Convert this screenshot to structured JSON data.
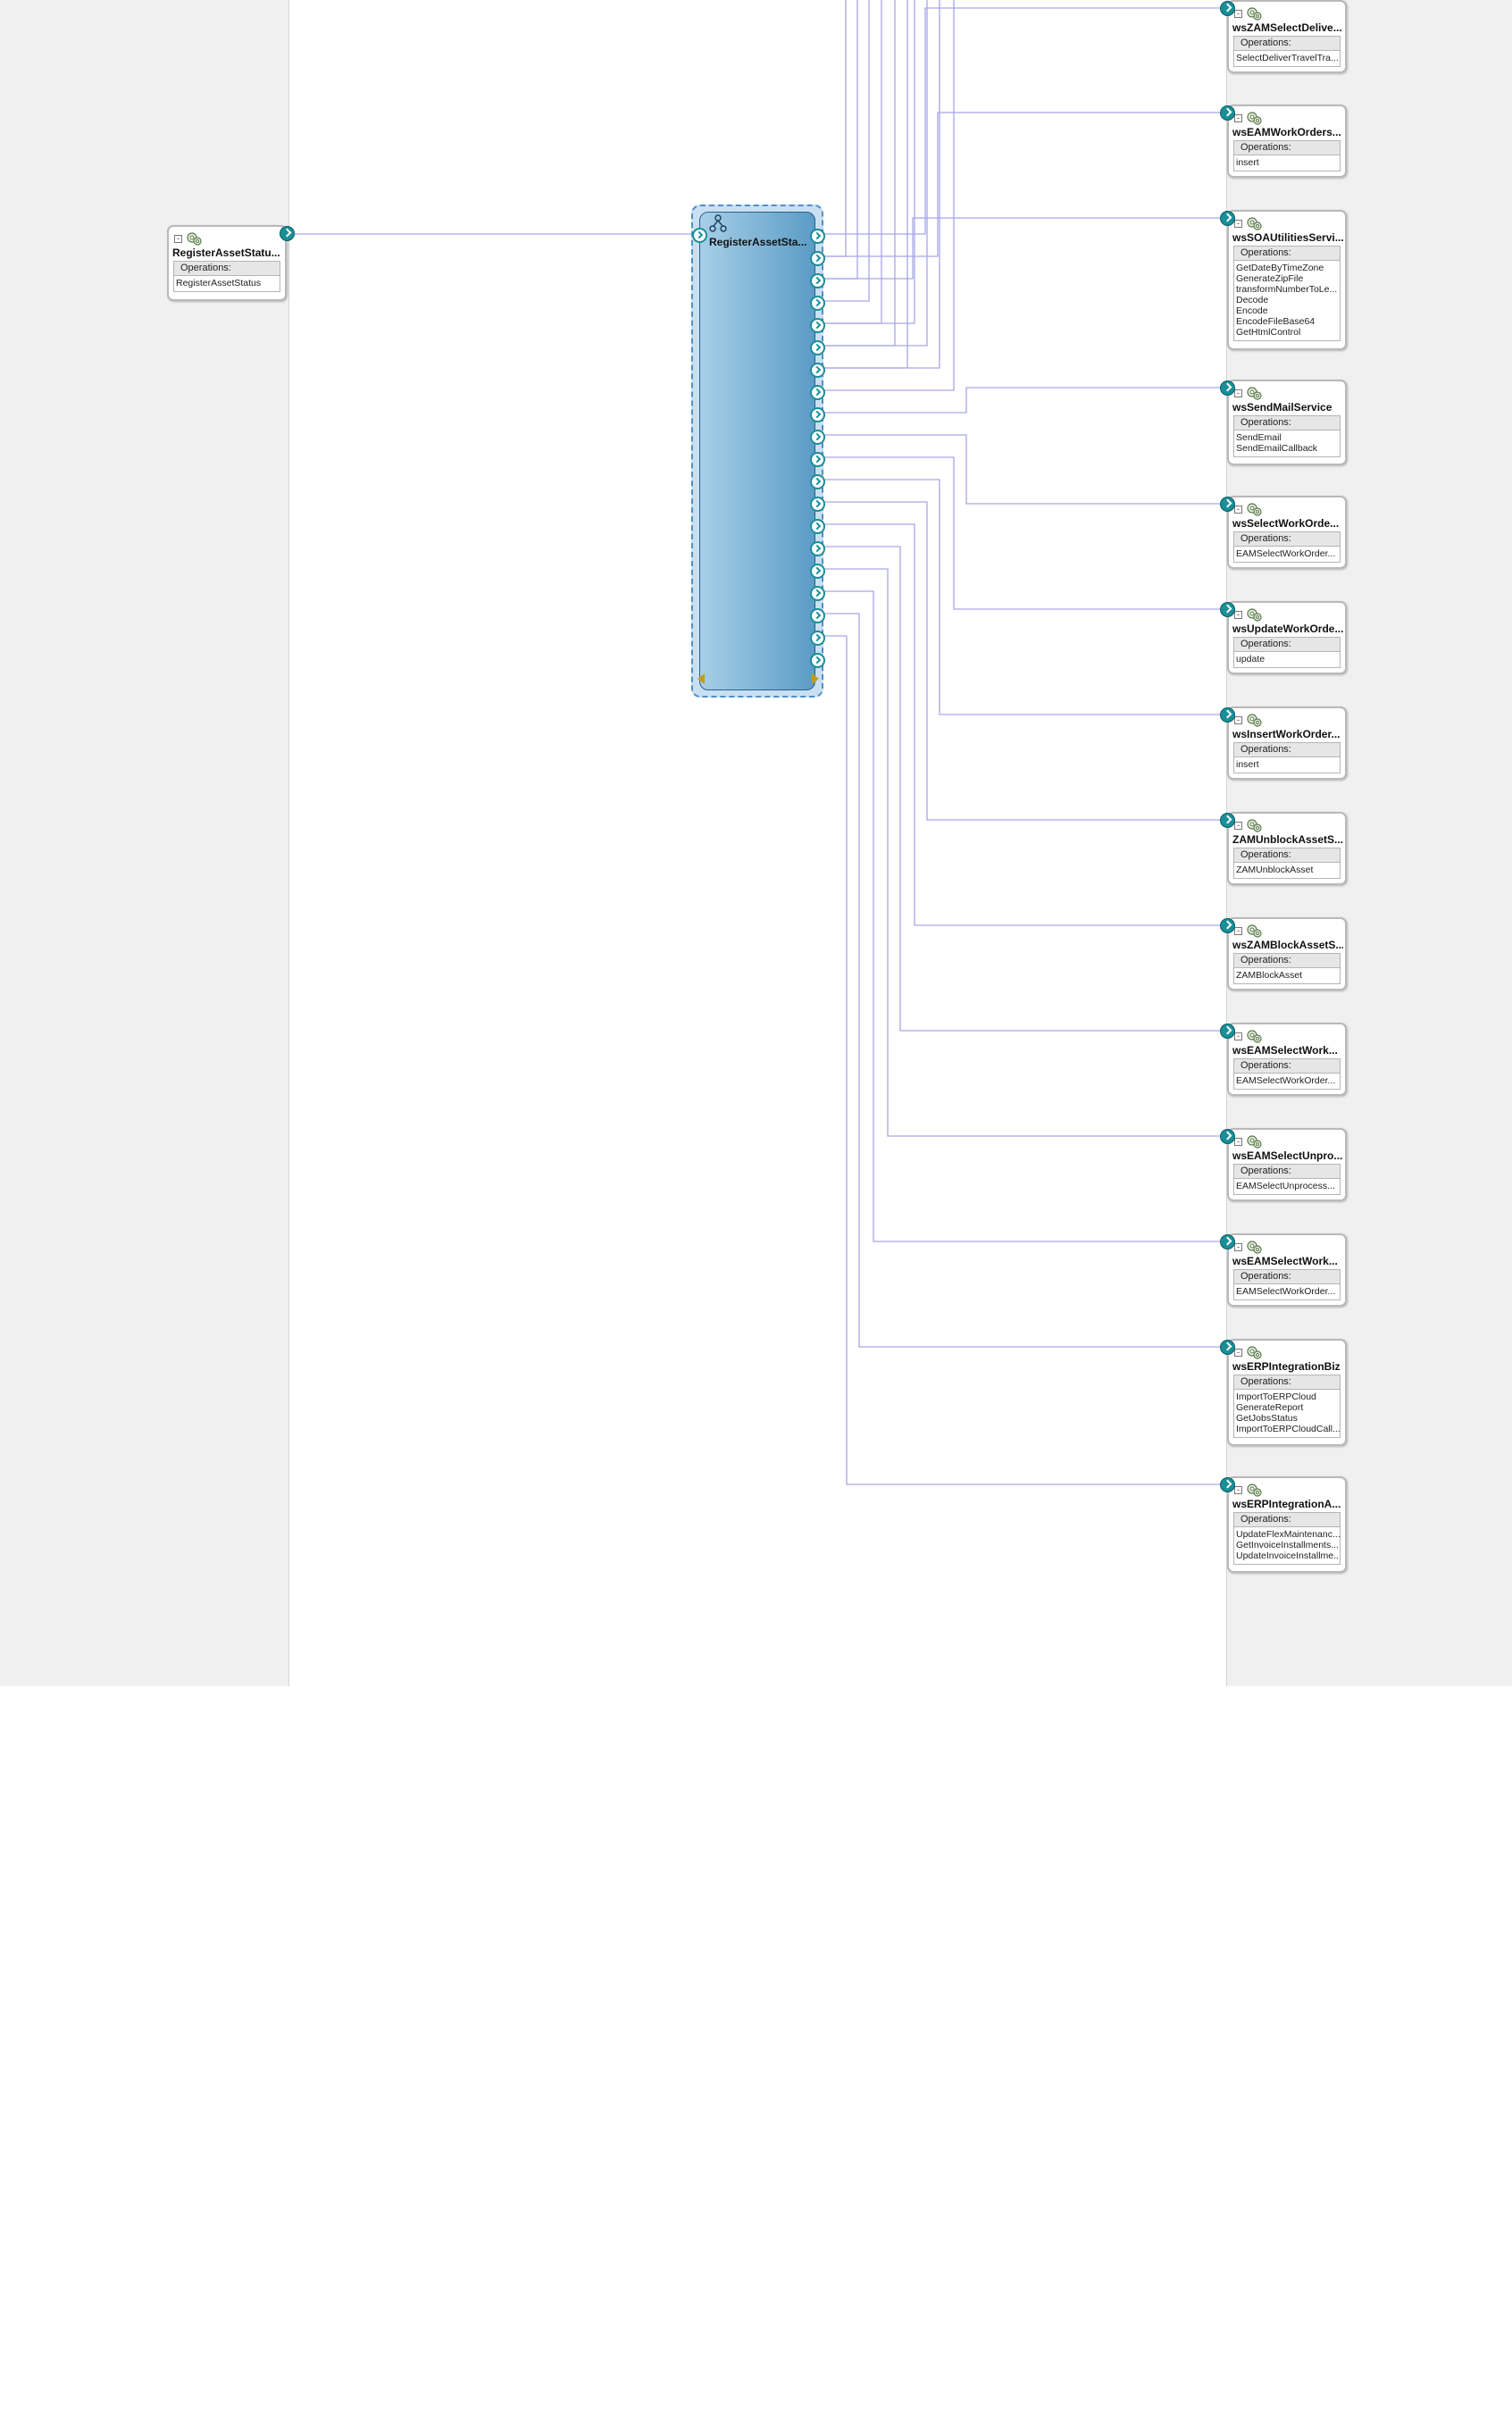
{
  "colors": {
    "wire": "#a9a6e6",
    "port": "#1a8f98",
    "lane": "#f0f0f0",
    "mediator": "#5b9cc6"
  },
  "icons": {
    "service": "gear-service-icon",
    "mediator": "mediator-icon",
    "collapse": "minus-icon"
  },
  "operations_label": "Operations:",
  "exposed_service": {
    "title": "RegisterAssetStatu...",
    "operations": [
      "RegisterAssetStatus"
    ]
  },
  "mediator": {
    "title": "RegisterAssetSta..."
  },
  "references": [
    {
      "title": "wsZAMSelectDelive...",
      "operations": [
        "SelectDeliverTravelTra..."
      ]
    },
    {
      "title": "wsEAMWorkOrders...",
      "operations": [
        "insert"
      ]
    },
    {
      "title": "wsSOAUtilitiesServi...",
      "operations": [
        "GetDateByTimeZone",
        "GenerateZipFile",
        "transformNumberToLe...",
        "Decode",
        "Encode",
        "EncodeFileBase64",
        "GetHtmlControl"
      ]
    },
    {
      "title": "wsSendMailService",
      "operations": [
        "SendEmail",
        "SendEmailCallback"
      ]
    },
    {
      "title": "wsSelectWorkOrde...",
      "operations": [
        "EAMSelectWorkOrder..."
      ]
    },
    {
      "title": "wsUpdateWorkOrde...",
      "operations": [
        "update"
      ]
    },
    {
      "title": "wsInsertWorkOrder...",
      "operations": [
        "insert"
      ]
    },
    {
      "title": "ZAMUnblockAssetS...",
      "operations": [
        "ZAMUnblockAsset"
      ]
    },
    {
      "title": "wsZAMBlockAssetS...",
      "operations": [
        "ZAMBlockAsset"
      ]
    },
    {
      "title": "wsEAMSelectWork...",
      "operations": [
        "EAMSelectWorkOrder..."
      ]
    },
    {
      "title": "wsEAMSelectUnpro...",
      "operations": [
        "EAMSelectUnprocess..."
      ]
    },
    {
      "title": "wsEAMSelectWork...",
      "operations": [
        "EAMSelectWorkOrder..."
      ]
    },
    {
      "title": "wsERPIntegrationBiz",
      "operations": [
        "ImportToERPCloud",
        "GenerateReport",
        "GetJobsStatus",
        "ImportToERPCloudCall..."
      ]
    },
    {
      "title": "wsERPIntegrationA...",
      "operations": [
        "UpdateFlexMaintenanc...",
        "GetInvoiceInstallments...",
        "UpdateInvoiceInstallme..."
      ]
    }
  ]
}
